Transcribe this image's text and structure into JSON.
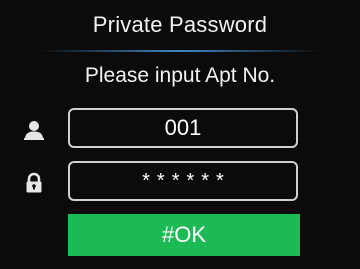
{
  "header": {
    "title": "Private Password"
  },
  "prompt": "Please input Apt No.",
  "apartment_field": {
    "icon": "user-icon",
    "value": "001"
  },
  "password_field": {
    "icon": "lock-icon",
    "masked_value": "******"
  },
  "ok_button": {
    "label": "#OK"
  },
  "colors": {
    "background": "#0b0b0b",
    "accent_green": "#1db954",
    "divider_blue": "#3f87c6",
    "field_border": "#cfcfcf"
  }
}
